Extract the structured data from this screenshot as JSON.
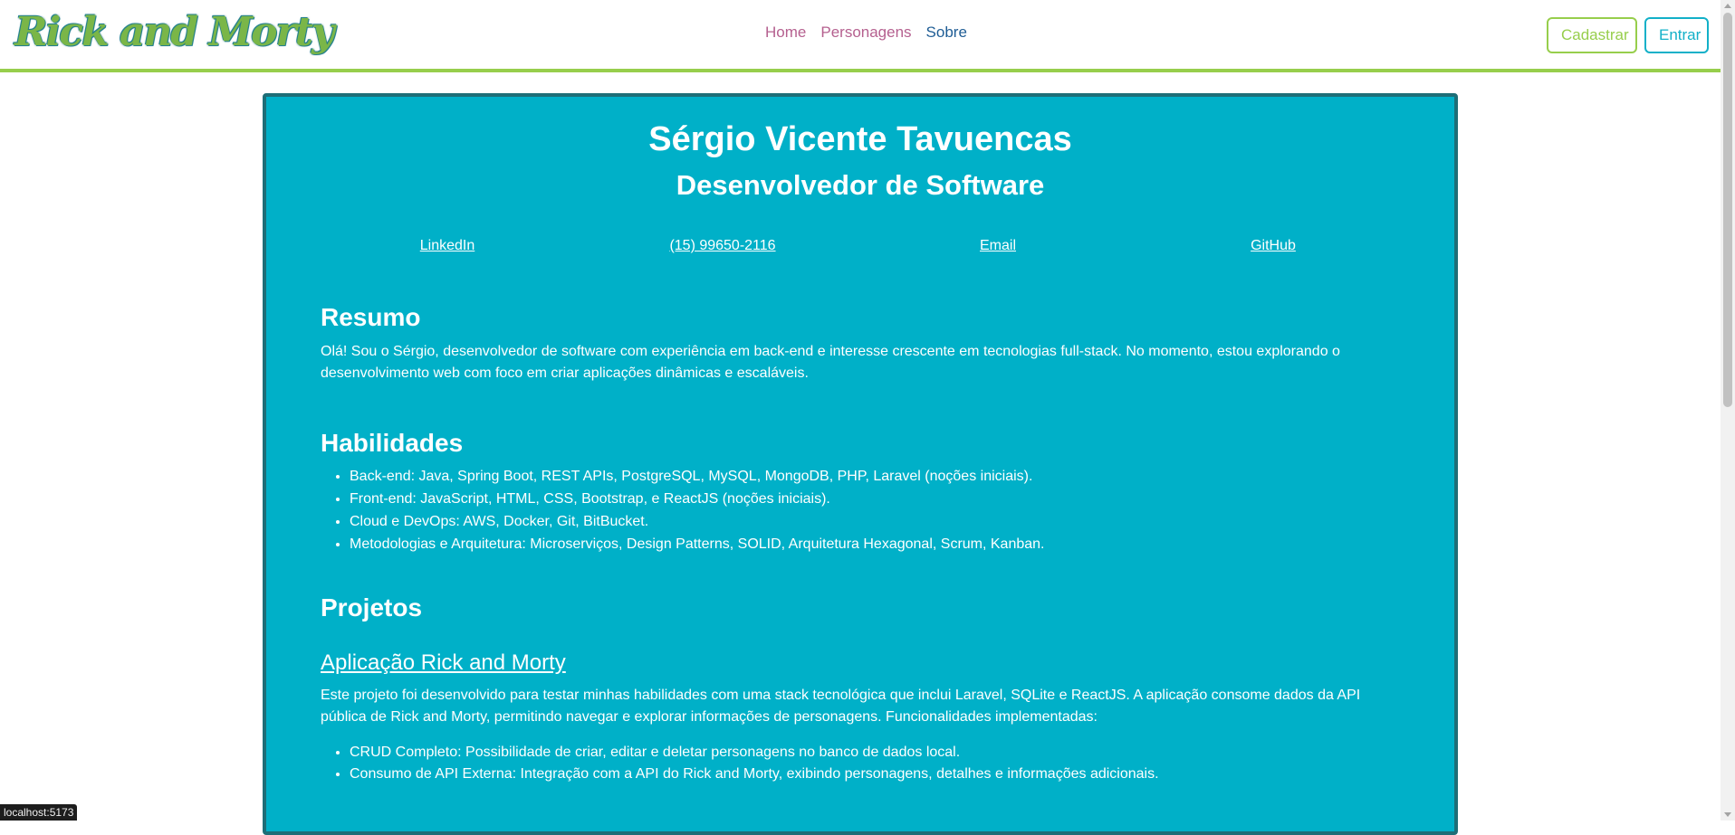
{
  "brand": {
    "logo_text": "Rick and Morty"
  },
  "nav": {
    "home": "Home",
    "characters": "Personagens",
    "about": "Sobre"
  },
  "auth": {
    "register": "Cadastrar",
    "login": "Entrar"
  },
  "profile": {
    "name": "Sérgio Vicente Tavuencas",
    "role": "Desenvolvedor de Software",
    "contacts": [
      "LinkedIn",
      "(15) 99650-2116",
      "Email",
      "GitHub"
    ]
  },
  "summary": {
    "heading": "Resumo",
    "text": "Olá! Sou o Sérgio, desenvolvedor de software com experiência em back-end e interesse crescente em tecnologias full-stack. No momento, estou explorando o desenvolvimento web com foco em criar aplicações dinâmicas e escaláveis."
  },
  "skills": {
    "heading": "Habilidades",
    "items": [
      "Back-end: Java, Spring Boot, REST APIs, PostgreSQL, MySQL, MongoDB, PHP, Laravel (noções iniciais).",
      "Front-end: JavaScript, HTML, CSS, Bootstrap, e ReactJS (noções iniciais).",
      "Cloud e DevOps: AWS, Docker, Git, BitBucket.",
      "Metodologias e Arquitetura: Microserviços, Design Patterns, SOLID, Arquitetura Hexagonal, Scrum, Kanban."
    ]
  },
  "projects": {
    "heading": "Projetos",
    "items": [
      {
        "title": "Aplicação Rick and Morty",
        "description": "Este projeto foi desenvolvido para testar minhas habilidades com uma stack tecnológica que inclui Laravel, SQLite e ReactJS. A aplicação consome dados da API pública de Rick and Morty, permitindo navegar e explorar informações de personagens. Funcionalidades implementadas:",
        "features": [
          "CRUD Completo: Possibilidade de criar, editar e deletar personagens no banco de dados local.",
          "Consumo de API Externa: Integração com a API do Rick and Morty, exibindo personagens, detalhes e informações adicionais."
        ]
      }
    ]
  },
  "statusbar": {
    "url": "localhost:5173"
  }
}
